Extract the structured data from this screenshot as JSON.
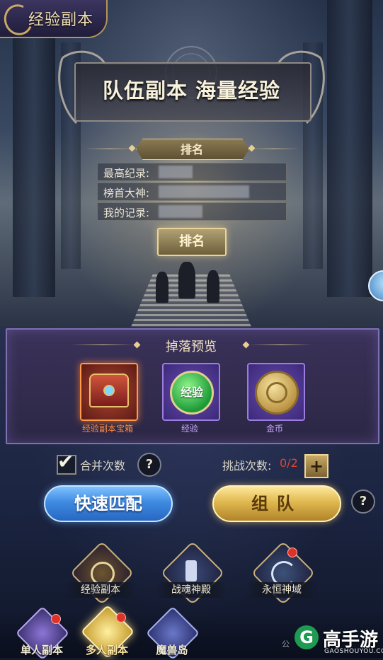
{
  "header": {
    "title": "经验副本"
  },
  "banner": {
    "title": "队伍副本  海量经验"
  },
  "rank_panel": {
    "header": "排名",
    "rows": [
      {
        "label": "最高纪录:"
      },
      {
        "label": "榜首大神:"
      },
      {
        "label": "我的记录:"
      }
    ],
    "button_label": "排名"
  },
  "drops": {
    "title": "掉落预览",
    "items": [
      {
        "label": "经验副本宝箱",
        "color": "#ff8a3d"
      },
      {
        "label": "经验",
        "color": "#c8a7ff",
        "icon_text": "经验"
      },
      {
        "label": "金币",
        "color": "#c8a7ff"
      }
    ]
  },
  "controls": {
    "merge_checked": true,
    "merge_label": "合并次数",
    "help_glyph": "?",
    "challenge_label": "挑战次数:",
    "challenge_count": "0/2",
    "plus_glyph": "+",
    "quick_match_label": "快速匹配",
    "team_label": "组队"
  },
  "dungeons": [
    {
      "label": "经验副本",
      "has_badge": false
    },
    {
      "label": "战魂神殿",
      "has_badge": false
    },
    {
      "label": "永恒神域",
      "has_badge": true
    }
  ],
  "bottom_nav": [
    {
      "label": "单人副本",
      "has_badge": true
    },
    {
      "label": "多人副本",
      "has_badge": true,
      "active": true
    },
    {
      "label": "魔兽岛",
      "has_badge": false
    }
  ],
  "watermark": {
    "logo_glyph": "G",
    "name": "高手游",
    "site": "GAOSHOUYOU.COM",
    "fragment": "公"
  },
  "colors": {
    "gold": "#e0c98a",
    "purple_panel": "#3a3259",
    "quick_match": "#3f8be2",
    "team_button": "#e0b84f",
    "count_red": "#e2442f"
  }
}
